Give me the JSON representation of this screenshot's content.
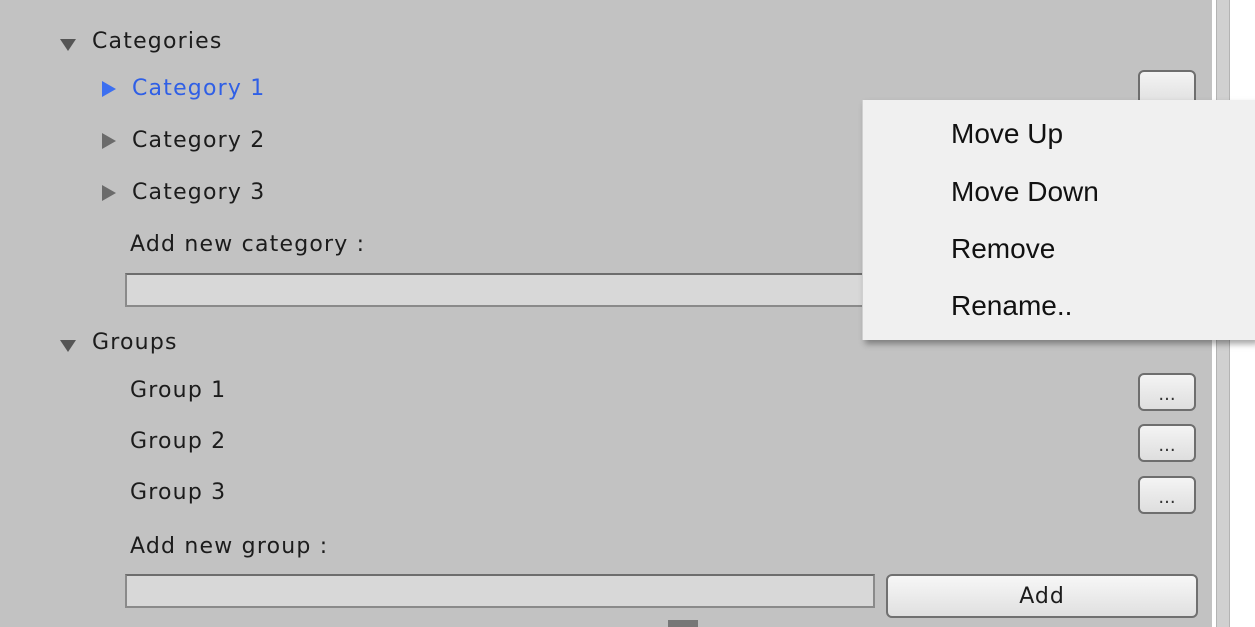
{
  "categories": {
    "header": "Categories",
    "items": [
      {
        "label": "Category 1",
        "selected": true
      },
      {
        "label": "Category 2",
        "selected": false
      },
      {
        "label": "Category 3",
        "selected": false
      }
    ],
    "add_label": "Add new category :",
    "add_value": ""
  },
  "groups": {
    "header": "Groups",
    "items": [
      {
        "label": "Group 1",
        "button": "..."
      },
      {
        "label": "Group 2",
        "button": "..."
      },
      {
        "label": "Group 3",
        "button": "..."
      }
    ],
    "add_label": "Add new group :",
    "add_value": "",
    "add_button": "Add"
  },
  "context_menu": {
    "items": [
      "Move Up",
      "Move Down",
      "Remove",
      "Rename.."
    ]
  },
  "colors": {
    "panel_bg": "#c2c2c2",
    "selected_text": "#2f5fe6",
    "menu_bg": "#f0f0f0"
  }
}
